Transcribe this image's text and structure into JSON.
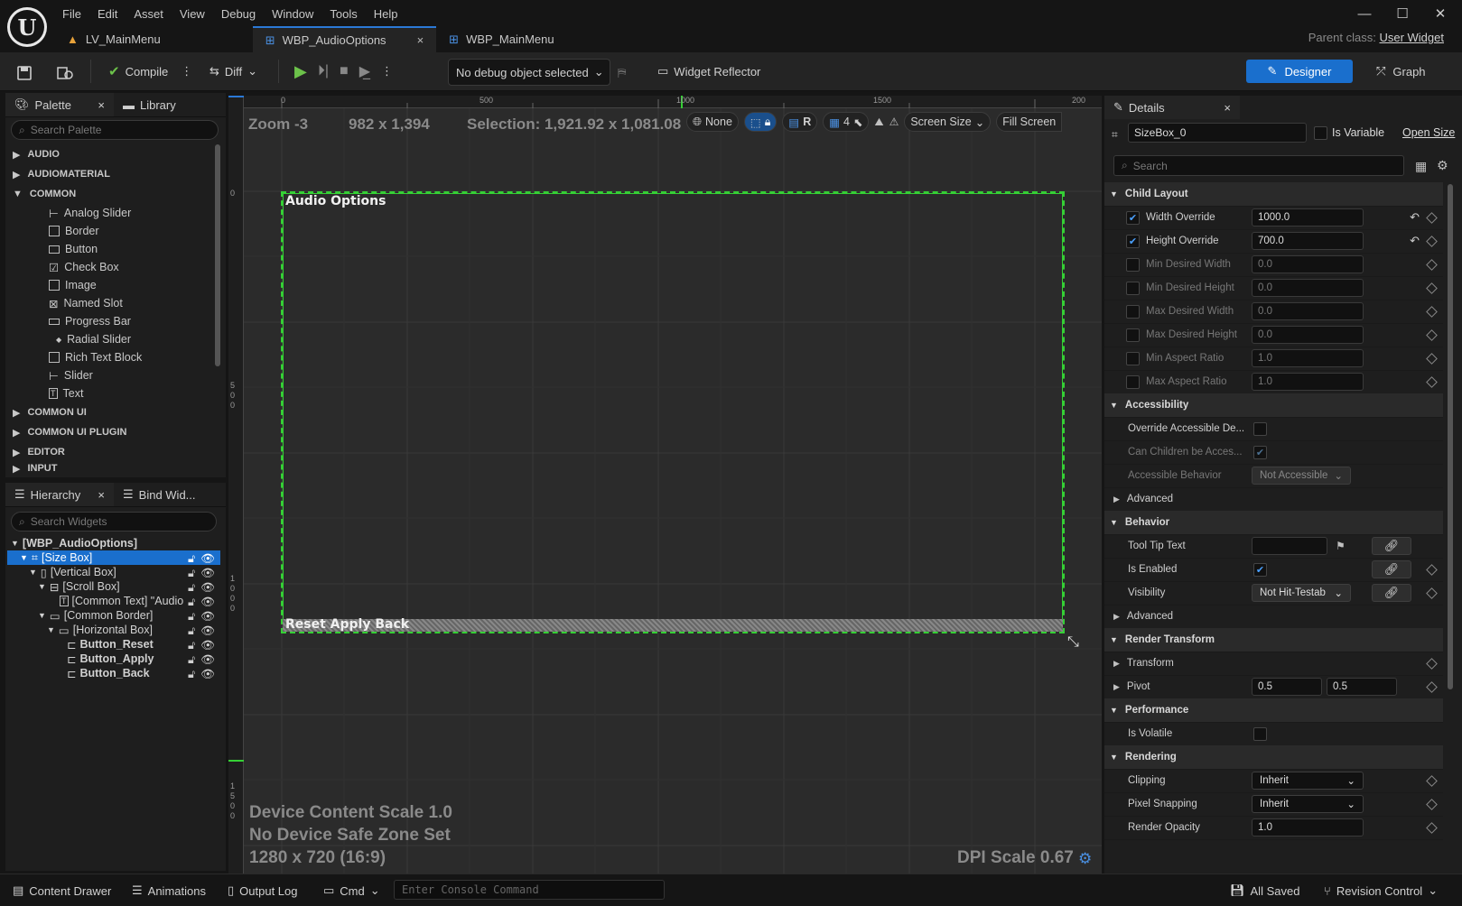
{
  "menu": [
    "File",
    "Edit",
    "Asset",
    "View",
    "Debug",
    "Window",
    "Tools",
    "Help"
  ],
  "tabs": [
    {
      "label": "LV_MainMenu"
    },
    {
      "label": "WBP_AudioOptions",
      "close": "×"
    },
    {
      "label": "WBP_MainMenu"
    }
  ],
  "parent_class": {
    "label": "Parent class:",
    "value": "User Widget"
  },
  "toolbar": {
    "compile": "Compile",
    "diff": "Diff",
    "debug_object": "No debug object selected",
    "widget_reflector": "Widget Reflector",
    "designer": "Designer",
    "graph": "Graph"
  },
  "palette": {
    "tab": "Palette",
    "tab2": "Library",
    "search_placeholder": "Search Palette",
    "categories_top": [
      "AUDIO",
      "AUDIOMATERIAL",
      "COMMON"
    ],
    "items": [
      "Analog Slider",
      "Border",
      "Button",
      "Check Box",
      "Image",
      "Named Slot",
      "Progress Bar",
      "Radial Slider",
      "Rich Text Block",
      "Slider",
      "Text"
    ],
    "categories_bottom": [
      "COMMON UI",
      "COMMON UI PLUGIN",
      "EDITOR",
      "INPUT"
    ]
  },
  "hierarchy": {
    "tab": "Hierarchy",
    "tab2": "Bind Wid...",
    "search_placeholder": "Search Widgets",
    "rows": [
      "[WBP_AudioOptions]",
      "[Size Box]",
      "[Vertical Box]",
      "[Scroll Box]",
      "[Common Text] \"Audio",
      "[Common Border]",
      "[Horizontal Box]",
      "Button_Reset",
      "Button_Apply",
      "Button_Back"
    ]
  },
  "canvas": {
    "zoom": "Zoom -3",
    "size": "982 x 1,394",
    "selection": "Selection: 1,921.92 x 1,081.08",
    "none": "None",
    "r": "R",
    "grid": "4",
    "screen_size": "Screen Size",
    "fill_screen": "Fill Screen",
    "ruler_labels": [
      "0",
      "500",
      "1000",
      "1500",
      "200"
    ],
    "vruler_labels": [
      "0",
      "5 0 0",
      "1 0 0 0",
      "1 5 0 0"
    ],
    "widget_title": "Audio Options",
    "widget_buttons": "Reset Apply Back",
    "device_scale": "Device Content Scale 1.0",
    "safe_zone": "No Device Safe Zone Set",
    "resolution": "1280 x 720 (16:9)",
    "dpi": "DPI Scale 0.67"
  },
  "details": {
    "tab": "Details",
    "name": "SizeBox_0",
    "is_variable": "Is Variable",
    "open_size": "Open Size",
    "search_placeholder": "Search",
    "sections": {
      "child_layout": "Child Layout",
      "accessibility": "Accessibility",
      "advanced": "Advanced",
      "behavior": "Behavior",
      "render_transform": "Render Transform",
      "performance": "Performance",
      "rendering": "Rendering"
    },
    "child_layout": [
      {
        "label": "Width Override",
        "value": "1000.0",
        "checked": true
      },
      {
        "label": "Height Override",
        "value": "700.0",
        "checked": true
      },
      {
        "label": "Min Desired Width",
        "value": "0.0"
      },
      {
        "label": "Min Desired Height",
        "value": "0.0"
      },
      {
        "label": "Max Desired Width",
        "value": "0.0"
      },
      {
        "label": "Max Desired Height",
        "value": "0.0"
      },
      {
        "label": "Min Aspect Ratio",
        "value": "1.0"
      },
      {
        "label": "Max Aspect Ratio",
        "value": "1.0"
      }
    ],
    "accessibility": {
      "override": "Override Accessible De...",
      "can_children": "Can Children be Acces...",
      "behavior_label": "Accessible Behavior",
      "behavior_value": "Not Accessible"
    },
    "behavior": {
      "tooltip": "Tool Tip Text",
      "is_enabled": "Is Enabled",
      "visibility": "Visibility",
      "visibility_value": "Not Hit-Testab"
    },
    "render_transform": {
      "transform": "Transform",
      "pivot": "Pivot",
      "pivot_x": "0.5",
      "pivot_y": "0.5"
    },
    "performance": {
      "is_volatile": "Is Volatile"
    },
    "rendering": {
      "clipping": "Clipping",
      "clipping_value": "Inherit",
      "pixel_snapping": "Pixel Snapping",
      "pixel_snapping_value": "Inherit",
      "render_opacity": "Render Opacity",
      "render_opacity_value": "1.0"
    }
  },
  "statusbar": {
    "content_drawer": "Content Drawer",
    "animations": "Animations",
    "output_log": "Output Log",
    "cmd": "Cmd",
    "console_placeholder": "Enter Console Command",
    "all_saved": "All Saved",
    "revision": "Revision Control"
  }
}
